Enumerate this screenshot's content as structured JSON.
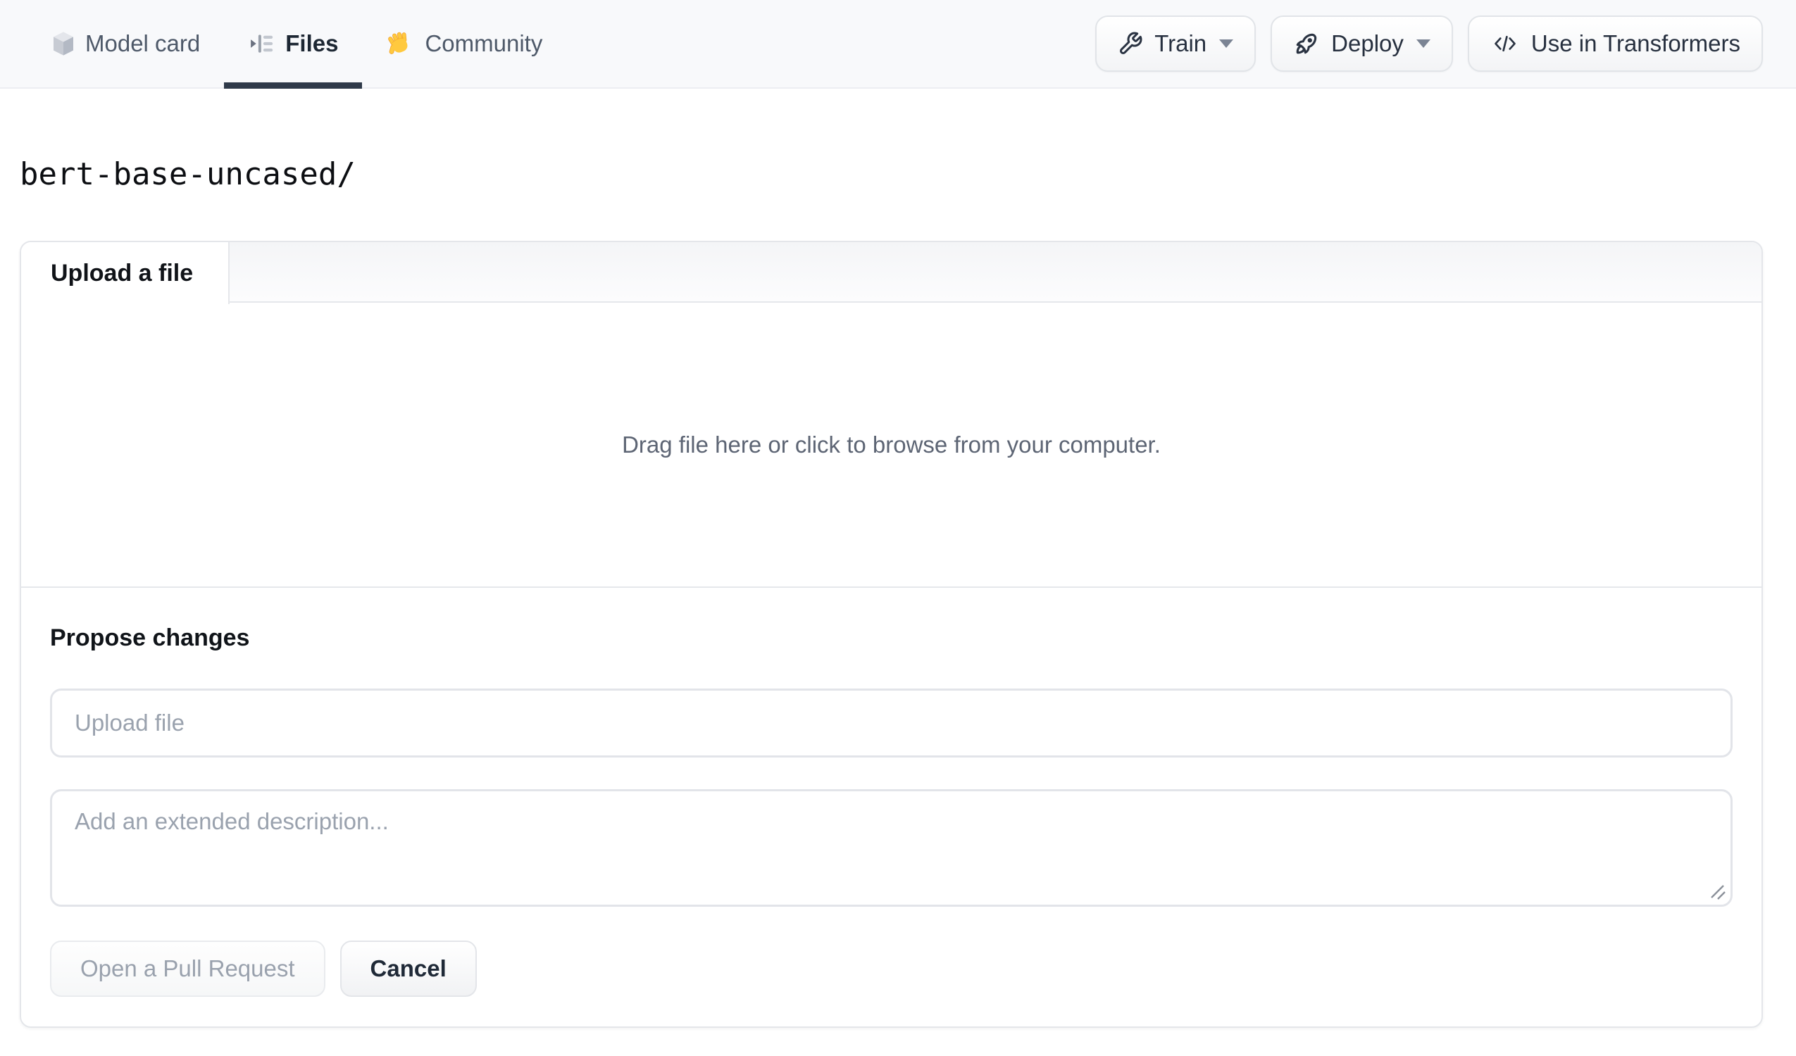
{
  "nav": {
    "tabs": [
      {
        "label": "Model card",
        "icon": "cube-icon",
        "active": false
      },
      {
        "label": "Files",
        "icon": "files-versions-icon",
        "active": true
      },
      {
        "label": "Community",
        "icon": "waving-hand-icon",
        "active": false
      }
    ],
    "actions": [
      {
        "label": "Train",
        "icon": "wrench-icon",
        "has_dropdown": true
      },
      {
        "label": "Deploy",
        "icon": "rocket-icon",
        "has_dropdown": true
      },
      {
        "label": "Use in Transformers",
        "icon": "code-icon",
        "has_dropdown": false
      }
    ]
  },
  "breadcrumb": {
    "path": "bert-base-uncased/"
  },
  "upload_panel": {
    "tab_label": "Upload a file",
    "dropzone_text": "Drag file here or click to browse from your computer.",
    "propose": {
      "heading": "Propose changes",
      "file_input_placeholder": "Upload file",
      "file_input_value": "",
      "description_placeholder": "Add an extended description...",
      "description_value": "",
      "submit_label": "Open a Pull Request",
      "cancel_label": "Cancel"
    }
  },
  "colors": {
    "nav_background": "#f8f9fb",
    "active_tab_underline": "#2f3a49",
    "active_text": "#1d2733",
    "inactive_text": "#4e5969",
    "muted_text": "#5d6574",
    "placeholder_text": "#9aa2ae",
    "border": "#e5e7eb",
    "hand_yellow": "#ffc93e"
  }
}
